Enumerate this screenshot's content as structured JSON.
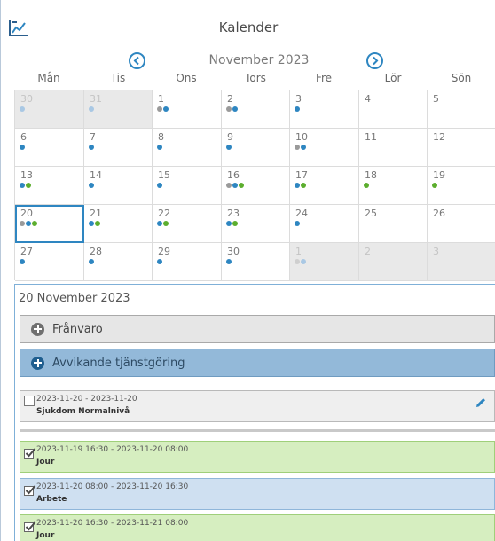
{
  "app": {
    "title": "Kalender"
  },
  "nav": {
    "month_label": "November 2023"
  },
  "weekdays": [
    "Mån",
    "Tis",
    "Ons",
    "Tors",
    "Fre",
    "Lör",
    "Sön"
  ],
  "colors": {
    "blue": "#2e86c1",
    "gray": "#9a9a9a",
    "green": "#5cae2e",
    "lightblue": "#a9c8e4",
    "lightgray": "#cfcfcf"
  },
  "calendar": {
    "weeks": [
      [
        {
          "day": "30",
          "other": true,
          "dots": [
            "lightblue"
          ]
        },
        {
          "day": "31",
          "other": true,
          "dots": [
            "lightblue"
          ]
        },
        {
          "day": "1",
          "dots": [
            "gray",
            "blue"
          ]
        },
        {
          "day": "2",
          "dots": [
            "gray",
            "blue"
          ]
        },
        {
          "day": "3",
          "dots": [
            "blue"
          ]
        },
        {
          "day": "4",
          "dots": []
        },
        {
          "day": "5",
          "dots": []
        }
      ],
      [
        {
          "day": "6",
          "dots": [
            "blue"
          ]
        },
        {
          "day": "7",
          "dots": [
            "blue"
          ]
        },
        {
          "day": "8",
          "dots": [
            "blue"
          ]
        },
        {
          "day": "9",
          "dots": [
            "blue"
          ]
        },
        {
          "day": "10",
          "dots": [
            "gray",
            "blue"
          ]
        },
        {
          "day": "11",
          "dots": []
        },
        {
          "day": "12",
          "dots": []
        }
      ],
      [
        {
          "day": "13",
          "dots": [
            "blue",
            "green"
          ]
        },
        {
          "day": "14",
          "dots": [
            "blue"
          ]
        },
        {
          "day": "15",
          "dots": [
            "blue"
          ]
        },
        {
          "day": "16",
          "dots": [
            "gray",
            "blue",
            "green"
          ]
        },
        {
          "day": "17",
          "dots": [
            "blue",
            "green"
          ]
        },
        {
          "day": "18",
          "dots": [
            "green"
          ]
        },
        {
          "day": "19",
          "dots": [
            "green"
          ]
        }
      ],
      [
        {
          "day": "20",
          "selected": true,
          "dots": [
            "gray",
            "blue",
            "green"
          ]
        },
        {
          "day": "21",
          "dots": [
            "blue",
            "green"
          ]
        },
        {
          "day": "22",
          "dots": [
            "blue",
            "green"
          ]
        },
        {
          "day": "23",
          "dots": [
            "blue",
            "green"
          ]
        },
        {
          "day": "24",
          "dots": [
            "blue"
          ]
        },
        {
          "day": "25",
          "dots": []
        },
        {
          "day": "26",
          "dots": []
        }
      ],
      [
        {
          "day": "27",
          "dots": [
            "blue"
          ]
        },
        {
          "day": "28",
          "dots": [
            "blue"
          ]
        },
        {
          "day": "29",
          "dots": [
            "blue"
          ]
        },
        {
          "day": "30",
          "dots": [
            "blue"
          ]
        },
        {
          "day": "1",
          "other": true,
          "dots": [
            "lightgray",
            "lightblue"
          ]
        },
        {
          "day": "2",
          "other": true,
          "dots": []
        },
        {
          "day": "3",
          "other": true,
          "dots": []
        }
      ]
    ]
  },
  "detail": {
    "date": "20 November 2023",
    "section_absence": "Frånvaro",
    "section_deviating": "Avvikande tjänstgöring",
    "entries": [
      {
        "time": "2023-11-20 - 2023-11-20",
        "kind": "Sjukdom Normalnivå",
        "checked": false
      },
      {
        "time": "2023-11-19 16:30 - 2023-11-20 08:00",
        "kind": "Jour",
        "checked": true
      },
      {
        "time": "2023-11-20 08:00 - 2023-11-20 16:30",
        "kind": "Arbete",
        "checked": true
      },
      {
        "time": "2023-11-20 16:30 - 2023-11-21 08:00",
        "kind": "Jour",
        "checked": true
      }
    ]
  }
}
